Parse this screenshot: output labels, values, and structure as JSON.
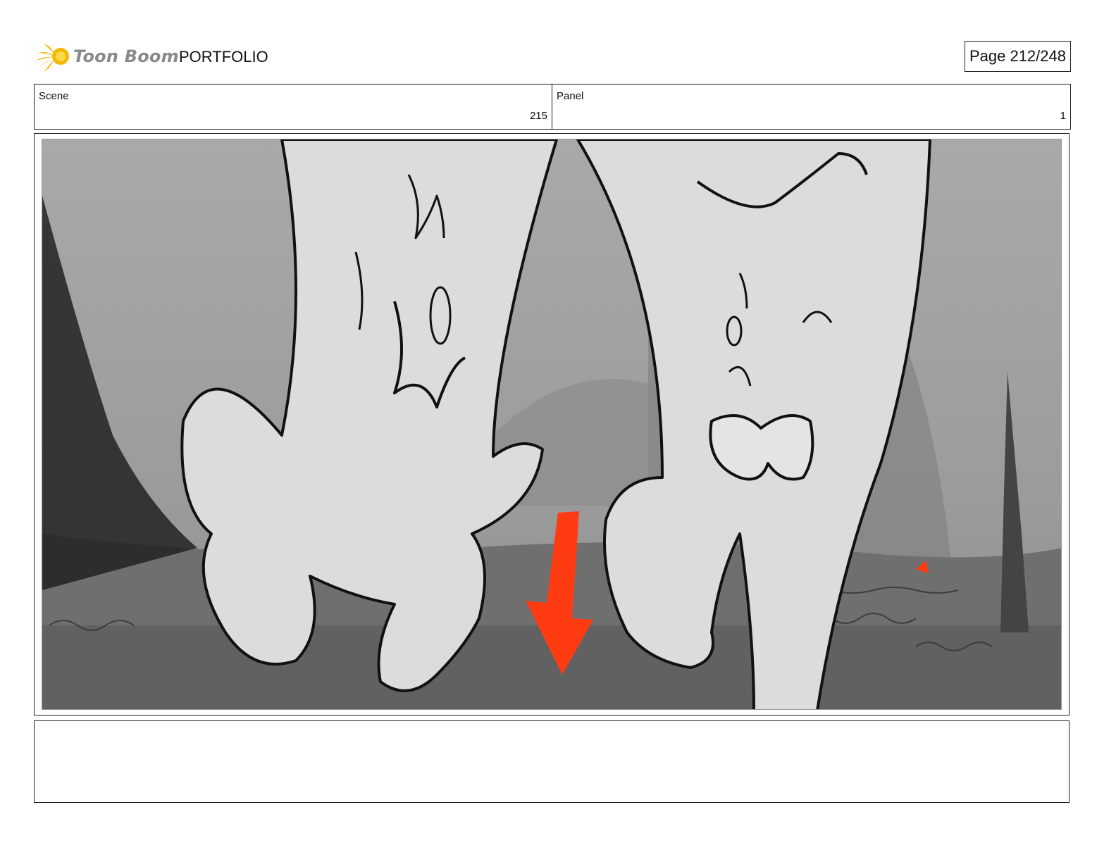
{
  "header": {
    "brand": "Toon Boom",
    "section": "PORTFOLIO",
    "page_indicator": "Page 212/248"
  },
  "info": {
    "scene_label": "Scene",
    "scene_value": "215",
    "panel_label": "Panel",
    "panel_value": "1"
  },
  "artwork": {
    "description_icons": [
      "logo-star-icon",
      "down-arrow-icon"
    ],
    "colors": {
      "arrow": "#ff3b12",
      "background_gray": "#b8b8b8",
      "character_fill": "#dcdcdc",
      "line": "#111111"
    }
  },
  "notes": {
    "text": ""
  }
}
